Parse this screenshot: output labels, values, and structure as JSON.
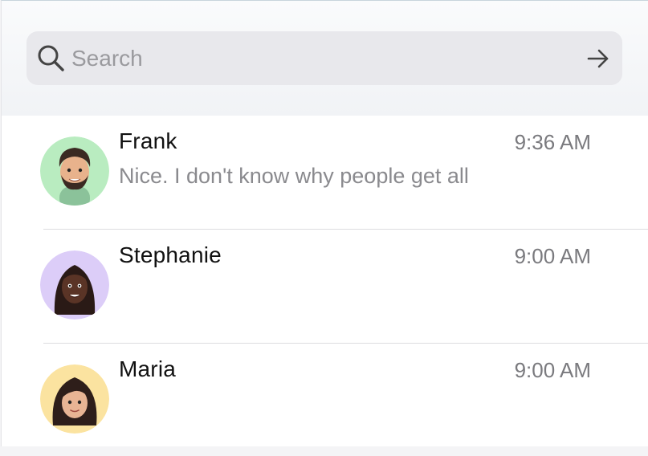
{
  "search": {
    "placeholder": "Search",
    "value": "",
    "icon": "search-icon",
    "go_icon": "arrow-right-icon"
  },
  "conversations": [
    {
      "name": "Frank",
      "time": "9:36 AM",
      "preview": "Nice. I don't know why people get all",
      "avatar_bg": "#b9ecc0",
      "avatar": "frank-avatar"
    },
    {
      "name": "Stephanie",
      "time": "9:00 AM",
      "preview": "",
      "avatar_bg": "#dccdf8",
      "avatar": "stephanie-avatar"
    },
    {
      "name": "Maria",
      "time": "9:00 AM",
      "preview": "",
      "avatar_bg": "#fbe3a0",
      "avatar": "maria-avatar"
    }
  ],
  "colors": {
    "search_bg": "#e8e8ec",
    "name_text": "#111111",
    "secondary_text": "#8a8a8e",
    "divider": "#dcdcdf"
  }
}
